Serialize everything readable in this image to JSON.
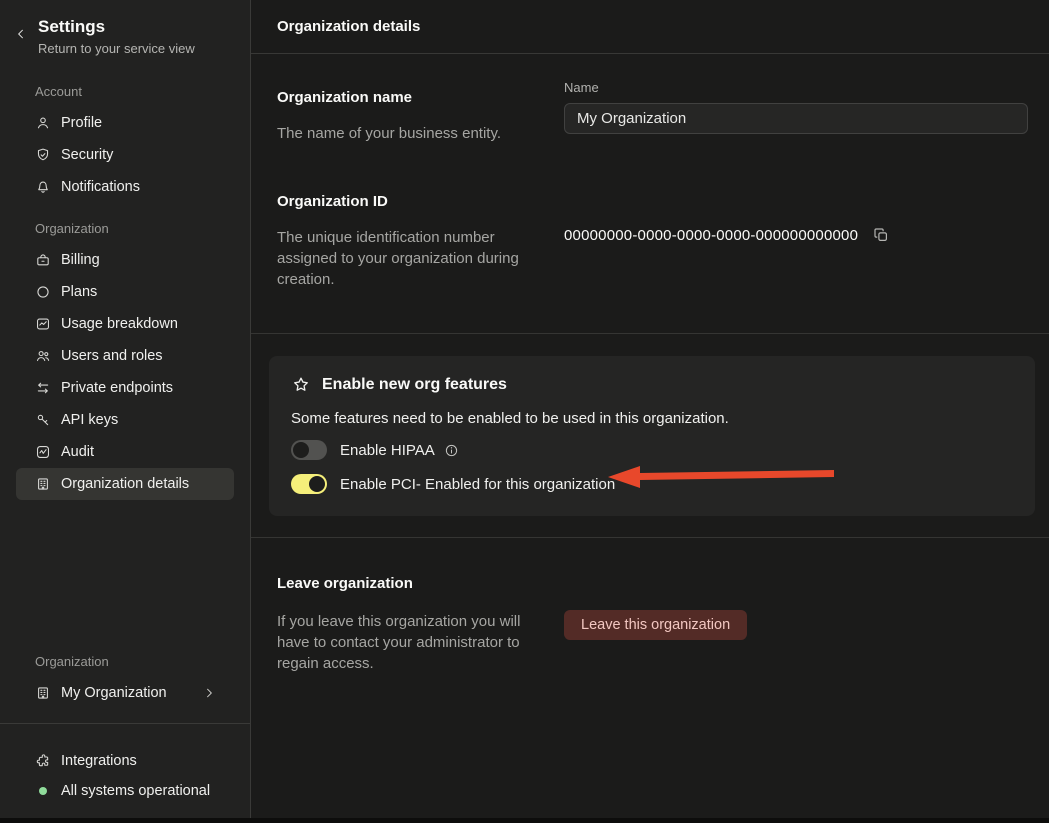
{
  "colors": {
    "accent_yellow": "#f5ef7a",
    "arrow_red": "#e8482b",
    "status_green": "#90dc9b",
    "danger_bg": "#532b26",
    "danger_text": "#f2c7c1"
  },
  "sidebar": {
    "title": "Settings",
    "subtitle": "Return to your service view",
    "sections": [
      {
        "label": "Account",
        "items": [
          {
            "label": "Profile",
            "icon": "user-icon",
            "selected": false
          },
          {
            "label": "Security",
            "icon": "shield-check-icon",
            "selected": false
          },
          {
            "label": "Notifications",
            "icon": "bell-icon",
            "selected": false
          }
        ]
      },
      {
        "label": "Organization",
        "items": [
          {
            "label": "Billing",
            "icon": "billing-icon",
            "selected": false
          },
          {
            "label": "Plans",
            "icon": "circle-icon",
            "selected": false
          },
          {
            "label": "Usage breakdown",
            "icon": "chart-icon",
            "selected": false
          },
          {
            "label": "Users and roles",
            "icon": "users-icon",
            "selected": false
          },
          {
            "label": "Private endpoints",
            "icon": "swap-arrows-icon",
            "selected": false
          },
          {
            "label": "API keys",
            "icon": "key-icon",
            "selected": false
          },
          {
            "label": "Audit",
            "icon": "audit-icon",
            "selected": false
          },
          {
            "label": "Organization details",
            "icon": "building-icon",
            "selected": true
          }
        ]
      }
    ],
    "org_switcher": {
      "label": "Organization",
      "name": "My Organization"
    },
    "footer": {
      "integrations": "Integrations",
      "status": "All systems operational"
    }
  },
  "main": {
    "header_title": "Organization details",
    "org_name": {
      "title": "Organization name",
      "description": "The name of your business entity.",
      "field_label": "Name",
      "field_value": "My Organization"
    },
    "org_id": {
      "title": "Organization ID",
      "description": "The unique identification number assigned to your organization during creation.",
      "value": "00000000-0000-0000-0000-000000000000"
    },
    "features": {
      "title": "Enable new org features",
      "description": "Some features need to be enabled to be used in this organization.",
      "toggles": [
        {
          "label": "Enable HIPAA",
          "state": "off",
          "has_info": true
        },
        {
          "label": "Enable PCI- Enabled for this organization",
          "state": "on",
          "has_info": false
        }
      ]
    },
    "leave": {
      "title": "Leave organization",
      "description": "If you leave this organization you will have to contact your administrator to regain access.",
      "button_label": "Leave this organization"
    }
  }
}
